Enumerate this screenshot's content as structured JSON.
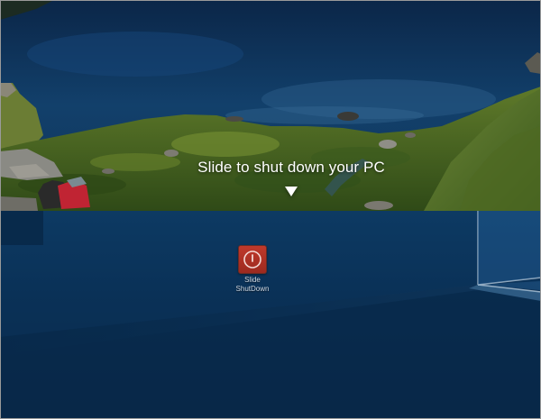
{
  "lock_screen": {
    "prompt_text": "Slide to shut down your PC",
    "arrow_icon": "down-triangle-icon"
  },
  "desktop": {
    "shortcuts": [
      {
        "label": "Slide\nShutDown",
        "icon": "power-icon",
        "icon_color": "#b5342a"
      }
    ]
  }
}
